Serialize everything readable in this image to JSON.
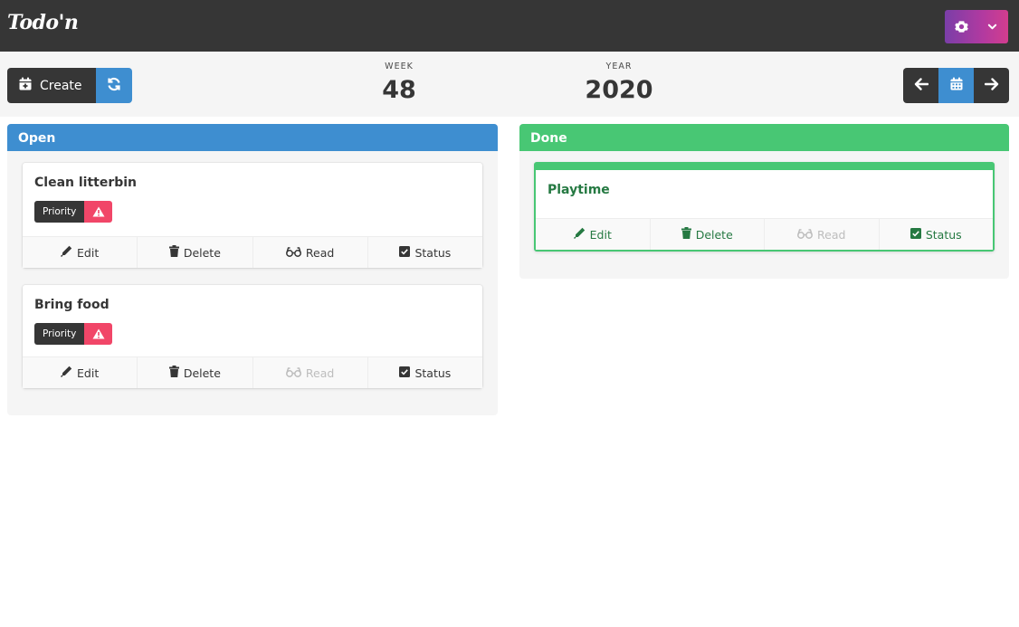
{
  "app": {
    "logo_text": "Todo'n"
  },
  "colors": {
    "navbar": "#363636",
    "accent_blue": "#3e8ed0",
    "done_green": "#48c774",
    "priority_red": "#f14668",
    "settings_gradient_start": "#7a3ea8",
    "settings_gradient_end": "#d23d8e"
  },
  "navbar": {
    "settings_icon": "gear-icon",
    "dropdown_icon": "chevron-down-icon"
  },
  "toolbar": {
    "create_label": "Create",
    "create_icon": "calendar-plus-icon",
    "refresh_icon": "refresh-icon",
    "week_caption": "WEEK",
    "week_value": "48",
    "year_caption": "YEAR",
    "year_value": "2020",
    "prev_icon": "arrow-left-icon",
    "calendar_icon": "calendar-icon",
    "next_icon": "arrow-right-icon"
  },
  "columns": [
    {
      "title": "Open",
      "cards": [
        {
          "title": "Clean litterbin",
          "tag_label": "Priority",
          "actions": {
            "edit": "Edit",
            "delete": "Delete",
            "read": "Read",
            "status": "Status"
          },
          "read_enabled": true
        },
        {
          "title": "Bring food",
          "tag_label": "Priority",
          "actions": {
            "edit": "Edit",
            "delete": "Delete",
            "read": "Read",
            "status": "Status"
          },
          "read_enabled": false
        }
      ]
    },
    {
      "title": "Done",
      "cards": [
        {
          "title": "Playtime",
          "actions": {
            "edit": "Edit",
            "delete": "Delete",
            "read": "Read",
            "status": "Status"
          },
          "read_enabled": false
        }
      ]
    }
  ]
}
